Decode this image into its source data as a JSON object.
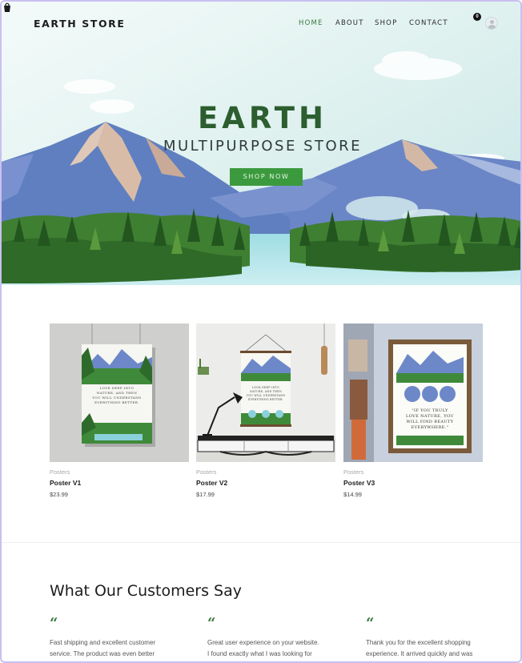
{
  "brand": "EARTH STORE",
  "nav": {
    "items": [
      {
        "label": "HOME",
        "active": true
      },
      {
        "label": "ABOUT",
        "active": false
      },
      {
        "label": "SHOP",
        "active": false
      },
      {
        "label": "CONTACT",
        "active": false
      }
    ],
    "cart_count": "0",
    "icons": [
      "cart-icon",
      "user-avatar-icon"
    ]
  },
  "hero": {
    "title": "EARTH",
    "subtitle": "MULTIPURPOSE STORE",
    "button": "SHOP NOW"
  },
  "products": [
    {
      "category": "Posters",
      "name": "Poster V1",
      "price": "$23.99",
      "poster_text": [
        "LOVE DEEP INTO",
        "NATURE, AND THEN",
        "YOU WILL UNDERSTAND",
        "EVERYTHING BETTER."
      ]
    },
    {
      "category": "Posters",
      "name": "Poster V2",
      "price": "$17.99",
      "poster_text": [
        "LOOK DEEP INTO",
        "NATURE, AND THEN",
        "YOU WILL UNDERSTAND",
        "EVERYTHING BETTER."
      ]
    },
    {
      "category": "Posters",
      "name": "Poster V3",
      "price": "$14.99",
      "poster_text": [
        "\"IF YOU TRULY",
        "LOVE NATURE, YOU",
        "WILL FIND BEAUTY",
        "EVERYWHERE.\""
      ]
    }
  ],
  "testimonials": {
    "title": "What Our Customers Say",
    "quote_mark": "“",
    "items": [
      {
        "line1": "Fast shipping and excellent customer",
        "line2": "service. The product was even better"
      },
      {
        "line1": "Great user experience on your website.",
        "line2": "I found exactly what I was looking for"
      },
      {
        "line1": "Thank you for the excellent shopping",
        "line2": "experience. It arrived quickly and was"
      }
    ]
  },
  "colors": {
    "accent_green": "#3c9a3e",
    "title_green": "#2c5e30",
    "sky": "#dff0ef",
    "mountain": "#5f7fc0",
    "lake": "#7fcfd9"
  }
}
